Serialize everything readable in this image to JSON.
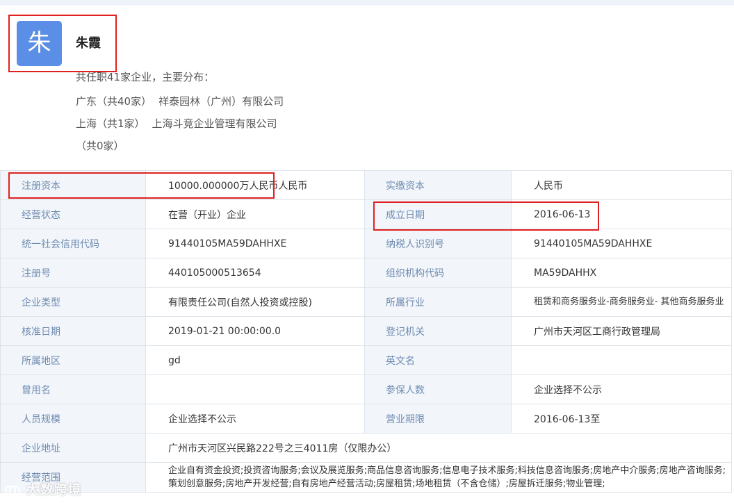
{
  "profile": {
    "avatar_char": "朱",
    "name": "朱霞",
    "summary": "共任职41家企业，主要分布：",
    "regions": [
      {
        "region": "广东（共40家）",
        "company": "祥泰园林（广州）有限公司"
      },
      {
        "region": "上海（共1家）",
        "company": "上海斗竞企业管理有限公司"
      },
      {
        "region": "（共0家）",
        "company": ""
      }
    ]
  },
  "rows": [
    {
      "l1": "注册资本",
      "v1": "10000.000000万人民币人民币",
      "l2": "实缴资本",
      "v2": "人民币"
    },
    {
      "l1": "经营状态",
      "v1": "在营（开业）企业",
      "l2": "成立日期",
      "v2": "2016-06-13"
    },
    {
      "l1": "统一社会信用代码",
      "v1": "91440105MA59DAHHXE",
      "l2": "纳税人识别号",
      "v2": "91440105MA59DAHHXE"
    },
    {
      "l1": "注册号",
      "v1": "440105000513654",
      "l2": "组织机构代码",
      "v2": "MA59DAHHX"
    },
    {
      "l1": "企业类型",
      "v1": "有限责任公司(自然人投资或控股)",
      "l2": "所属行业",
      "v2": "租赁和商务服务业-商务服务业- 其他商务服务业"
    },
    {
      "l1": "核准日期",
      "v1": "2019-01-21 00:00:00.0",
      "l2": "登记机关",
      "v2": "广州市天河区工商行政管理局"
    },
    {
      "l1": "所属地区",
      "v1": "gd",
      "l2": "英文名",
      "v2": ""
    },
    {
      "l1": "曾用名",
      "v1": "",
      "l2": "参保人数",
      "v2": "企业选择不公示"
    },
    {
      "l1": "人员规模",
      "v1": "企业选择不公示",
      "l2": "营业期限",
      "v2": "2016-06-13至"
    }
  ],
  "address": {
    "label": "企业地址",
    "value": "广州市天河区兴民路222号之三4011房（仅限办公）"
  },
  "scope": {
    "label": "经营范围",
    "value": "企业自有资金投资;投资咨询服务;会议及展览服务;商品信息咨询服务;信息电子技术服务;科技信息咨询服务;房地产中介服务;房地产咨询服务;策划创意服务;房地产开发经营;自有房地产经营活动;房屋租赁;场地租赁（不含仓储）;房屋拆迁服务;物业管理;"
  },
  "watermark": "大数跨境",
  "colors": {
    "avatar": "#5b8ee6",
    "label_text": "#6f8bb0",
    "label_bg": "#f2f6fb",
    "highlight": "#e02020"
  }
}
